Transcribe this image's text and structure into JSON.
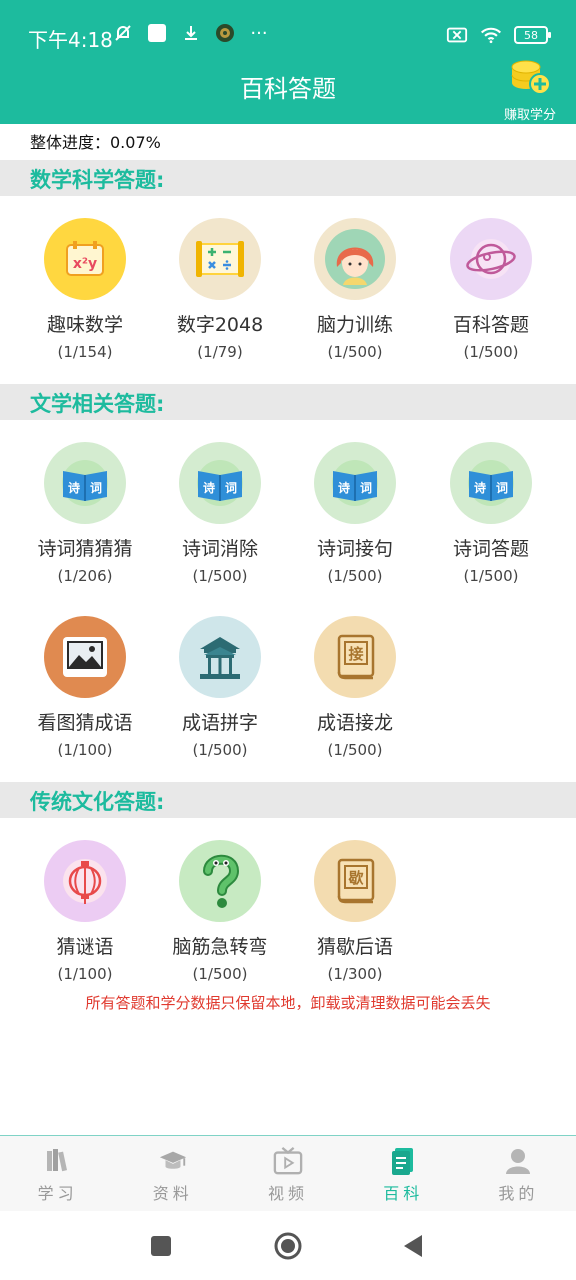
{
  "status_bar": {
    "time": "下午4:18",
    "battery": "58"
  },
  "header": {
    "title": "百科答题",
    "earn_label": "赚取学分"
  },
  "progress_text": "整体进度：0.07%",
  "sections": [
    {
      "title": "数学科学答题:",
      "items": [
        {
          "name": "趣味数学",
          "count": "(1/154)",
          "icon": "fun-math-icon"
        },
        {
          "name": "数字2048",
          "count": "(1/79)",
          "icon": "number-2048-icon"
        },
        {
          "name": "脑力训练",
          "count": "(1/500)",
          "icon": "brain-training-icon"
        },
        {
          "name": "百科答题",
          "count": "(1/500)",
          "icon": "encyclopedia-planet-icon"
        }
      ]
    },
    {
      "title": "文学相关答题:",
      "items": [
        {
          "name": "诗词猜猜猜",
          "count": "(1/206)",
          "icon": "poetry-book-icon"
        },
        {
          "name": "诗词消除",
          "count": "(1/500)",
          "icon": "poetry-book-icon"
        },
        {
          "name": "诗词接句",
          "count": "(1/500)",
          "icon": "poetry-book-icon"
        },
        {
          "name": "诗词答题",
          "count": "(1/500)",
          "icon": "poetry-book-icon"
        },
        {
          "name": "看图猜成语",
          "count": "(1/100)",
          "icon": "picture-icon"
        },
        {
          "name": "成语拼字",
          "count": "(1/500)",
          "icon": "pavilion-icon"
        },
        {
          "name": "成语接龙",
          "count": "(1/500)",
          "icon": "jie-book-icon"
        }
      ]
    },
    {
      "title": "传统文化答题:",
      "items": [
        {
          "name": "猜谜语",
          "count": "(1/100)",
          "icon": "lantern-icon"
        },
        {
          "name": "脑筋急转弯",
          "count": "(1/500)",
          "icon": "question-mark-icon"
        },
        {
          "name": "猜歇后语",
          "count": "(1/300)",
          "icon": "xie-book-icon"
        }
      ]
    }
  ],
  "icon_text": {
    "poetry_left": "诗",
    "poetry_right": "词",
    "jie": "接",
    "xie": "歇",
    "fun_math": "x²y"
  },
  "warning": "所有答题和学分数据只保留本地，卸载或清理数据可能会丢失",
  "tabs": [
    {
      "label": "学习",
      "icon": "books-icon"
    },
    {
      "label": "资料",
      "icon": "graduation-cap-icon"
    },
    {
      "label": "视频",
      "icon": "tv-play-icon"
    },
    {
      "label": "百科",
      "icon": "document-icon",
      "active": true
    },
    {
      "label": "我的",
      "icon": "user-icon"
    }
  ],
  "colors": {
    "accent": "#1dbb9e",
    "warning": "#e03a2f"
  }
}
